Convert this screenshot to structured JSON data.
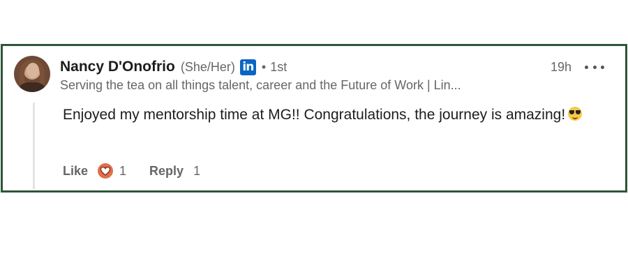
{
  "comment": {
    "author": {
      "name": "Nancy D'Onofrio",
      "pronouns": "(She/Her)",
      "badge": "in",
      "separator": "•",
      "degree": "1st",
      "headline": "Serving the tea on all things talent, career and the Future of Work | Lin..."
    },
    "timestamp": "19h",
    "text": "Enjoyed my mentorship time at MG!! Congratulations, the journey is amazing!",
    "emoji": "smiling-face-with-sunglasses",
    "actions": {
      "like_label": "Like",
      "reaction_icon": "love-heart-icon",
      "reaction_count": "1",
      "reply_label": "Reply",
      "reply_count": "1"
    }
  },
  "colors": {
    "border": "#2f5539",
    "linkedin_blue": "#0a66c2",
    "reaction": "#df704d",
    "muted_text": "#666666"
  }
}
